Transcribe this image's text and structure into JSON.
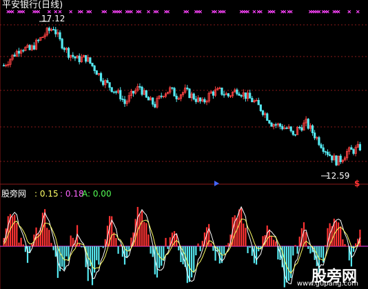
{
  "header": {
    "title": "平安银行(日线)"
  },
  "indicator": {
    "name": "股旁网",
    "value1": ": 0.15",
    "value2": ": 0.18",
    "value3": "A: 0.00"
  },
  "annotations": {
    "high": "17.12",
    "low": "12.59",
    "buy_marker": "$"
  },
  "watermark": {
    "text": "股旁网",
    "url": "www.gupang.com"
  },
  "colors": {
    "up": "#ff4444",
    "down": "#55e8f0",
    "marker": "#ff44ff",
    "grid": "#8b1a1a",
    "line_fast": "#ffffff",
    "line_slow": "#ffff66",
    "zero": "#ff44ff",
    "hist_pos": "#ff3333",
    "hist_neg": "#55e8f0"
  },
  "chart_data": [
    {
      "type": "candlestick",
      "title": "平安银行(日线)",
      "ylim": [
        12.0,
        17.5
      ],
      "high_label": 17.12,
      "low_label": 12.59,
      "price_path": [
        [
          0,
          15.8
        ],
        [
          4,
          16.1
        ],
        [
          8,
          16.4
        ],
        [
          12,
          16.3
        ],
        [
          16,
          16.6
        ],
        [
          20,
          16.9
        ],
        [
          23,
          17.05
        ],
        [
          26,
          16.6
        ],
        [
          30,
          16.2
        ],
        [
          34,
          16.0
        ],
        [
          38,
          16.05
        ],
        [
          42,
          15.7
        ],
        [
          46,
          15.3
        ],
        [
          50,
          15.05
        ],
        [
          54,
          14.8
        ],
        [
          56,
          14.55
        ],
        [
          60,
          14.9
        ],
        [
          63,
          15.1
        ],
        [
          66,
          14.7
        ],
        [
          70,
          14.5
        ],
        [
          74,
          14.9
        ],
        [
          77,
          15.0
        ],
        [
          80,
          14.8
        ],
        [
          84,
          14.95
        ],
        [
          88,
          14.75
        ],
        [
          92,
          14.55
        ],
        [
          96,
          14.9
        ],
        [
          100,
          14.95
        ],
        [
          104,
          14.8
        ],
        [
          108,
          15.0
        ],
        [
          112,
          14.8
        ],
        [
          116,
          14.6
        ],
        [
          120,
          14.3
        ],
        [
          124,
          13.9
        ],
        [
          128,
          13.8
        ],
        [
          132,
          13.7
        ],
        [
          134,
          13.45
        ],
        [
          136,
          13.7
        ],
        [
          140,
          13.9
        ],
        [
          144,
          13.5
        ],
        [
          148,
          13.1
        ],
        [
          151,
          12.85
        ],
        [
          154,
          12.65
        ],
        [
          156,
          12.7
        ],
        [
          159,
          12.95
        ],
        [
          162,
          13.0
        ],
        [
          165,
          13.1
        ]
      ],
      "top_markers": [
        [
          0,
          0,
          1,
          1,
          1,
          0,
          0,
          1,
          1,
          1,
          0,
          0,
          0,
          0,
          1,
          1,
          1,
          0,
          0,
          0,
          0,
          1,
          0,
          0,
          1,
          0,
          1,
          0,
          0,
          0,
          0,
          1,
          0,
          0,
          0,
          1,
          1,
          0,
          0,
          1,
          1,
          0,
          0,
          0,
          0,
          0,
          1,
          1,
          0,
          0,
          0,
          1,
          1,
          1,
          1,
          0,
          0,
          1,
          1,
          1,
          0,
          0,
          1,
          1,
          0,
          0,
          0,
          1,
          0,
          0,
          1,
          1,
          0,
          0,
          0,
          1,
          1,
          0,
          0,
          0,
          0,
          0,
          0,
          0,
          1,
          1,
          0,
          0,
          0,
          1,
          1,
          1,
          0,
          0,
          0,
          0,
          0,
          1,
          1,
          0,
          1,
          1,
          1,
          0,
          0,
          0,
          0,
          0,
          0,
          0,
          1,
          1,
          1,
          1,
          0,
          0,
          1,
          0,
          1,
          1,
          0,
          0,
          0,
          1,
          1,
          1,
          0,
          0,
          0,
          1,
          1,
          0,
          1,
          1,
          0,
          0,
          0,
          0,
          0,
          0,
          0,
          0,
          1,
          1,
          1,
          1,
          1,
          0,
          1,
          1,
          1,
          0,
          0,
          1,
          1,
          1,
          0,
          0,
          0,
          0,
          1,
          0,
          0,
          0,
          1,
          0
        ]
      ]
    },
    {
      "type": "line+bar",
      "name": "股旁网",
      "series": [
        {
          "name": "",
          "value": 0.15
        },
        {
          "name": "",
          "value": 0.18
        },
        {
          "name": "A",
          "value": 0.0
        }
      ],
      "ylim": [
        -1.0,
        1.0
      ]
    }
  ]
}
